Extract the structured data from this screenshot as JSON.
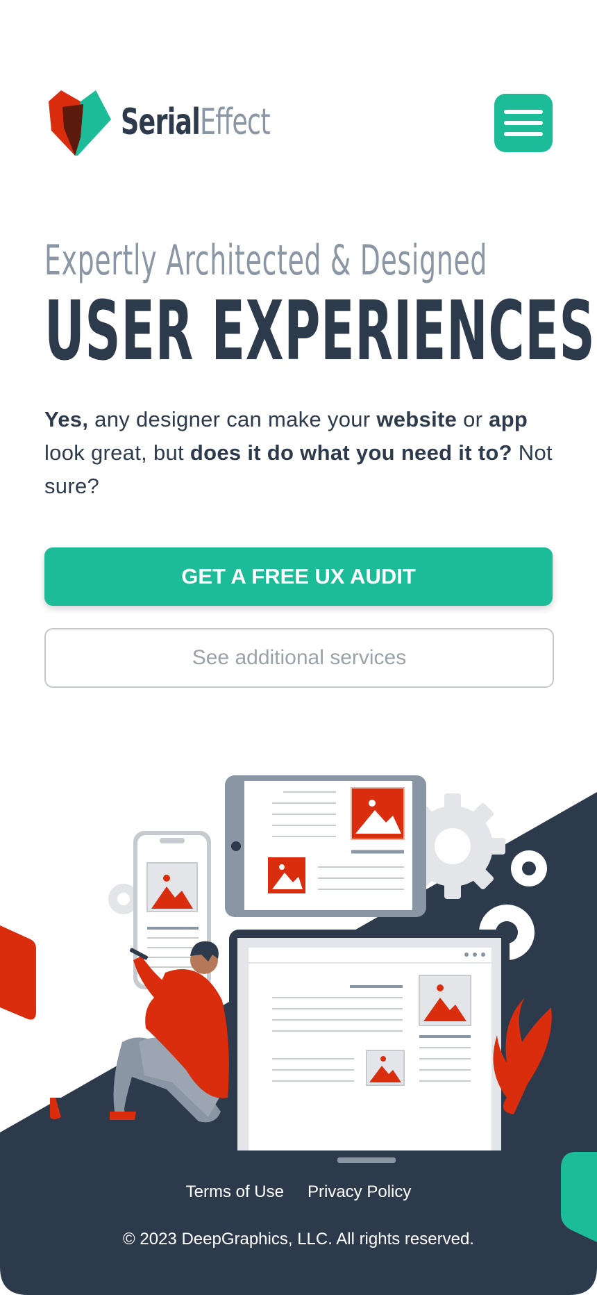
{
  "brand": {
    "name_part1": "Serial",
    "name_part2": "Effect",
    "colors": {
      "teal": "#1dbc98",
      "navy": "#2d3a4b",
      "red": "#d92d0e",
      "gray": "#8a96a3"
    }
  },
  "header": {
    "menu_icon": "hamburger-menu-icon"
  },
  "hero": {
    "kicker": "Expertly Architected & Designed",
    "headline": "USER EXPERIENCES",
    "intro": {
      "p1": "Yes,",
      "p2": " any designer can make your ",
      "p3": "website",
      "p4": " or ",
      "p5": "app",
      "p6": " look great, but ",
      "p7": "does it do what you need it to?",
      "p8": " Not sure?"
    },
    "cta_label": "GET A FREE UX AUDIT",
    "secondary_label": "See additional services"
  },
  "footer": {
    "links": [
      "Terms of Use",
      "Privacy Policy"
    ],
    "copyright": "© 2023 DeepGraphics, LLC. All rights reserved."
  }
}
